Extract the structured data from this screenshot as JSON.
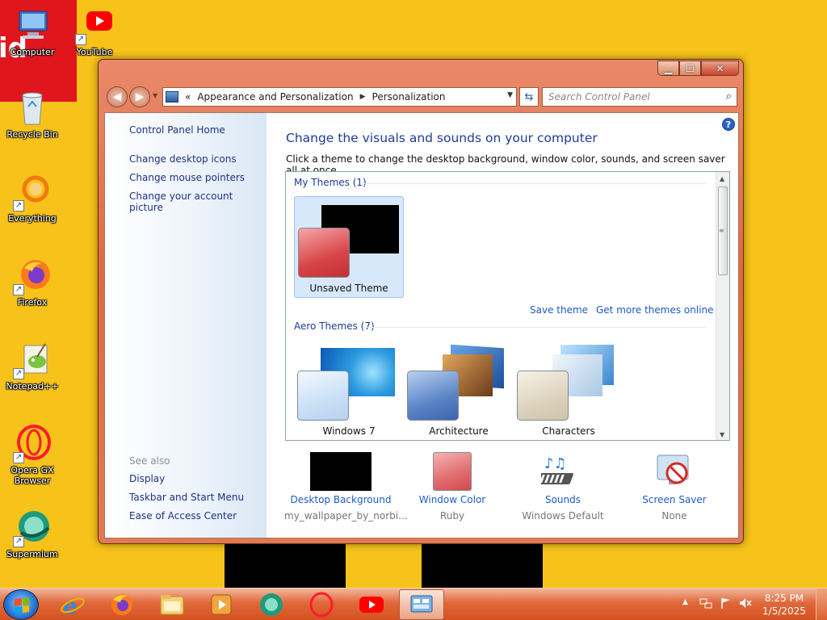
{
  "desktop": {
    "brand_fragment": "id",
    "icons": [
      {
        "label": "Computer",
        "icon": "computer-icon"
      },
      {
        "label": "YouTube",
        "icon": "youtube-icon"
      },
      {
        "label": "Recycle Bin",
        "icon": "recycle-bin-icon"
      },
      {
        "label": "Everything",
        "icon": "everything-search-icon"
      },
      {
        "label": "Firefox",
        "icon": "firefox-icon"
      },
      {
        "label": "Notepad++",
        "icon": "notepad-plus-plus-icon"
      },
      {
        "label": "Opera GX Browser",
        "icon": "opera-gx-icon"
      },
      {
        "label": "Supermium",
        "icon": "supermium-icon"
      }
    ],
    "background_color": "#f7c31a"
  },
  "window": {
    "caption_buttons": {
      "minimize": "▁",
      "maximize": "☐",
      "close": "✕"
    },
    "address": {
      "prefix": "«",
      "crumbs": [
        "Appearance and Personalization",
        "Personalization"
      ]
    },
    "search": {
      "placeholder": "Search Control Panel"
    },
    "left_pane": {
      "home": "Control Panel Home",
      "links": [
        "Change desktop icons",
        "Change mouse pointers",
        "Change your account picture"
      ],
      "see_also_label": "See also",
      "see_also": [
        "Display",
        "Taskbar and Start Menu",
        "Ease of Access Center"
      ]
    },
    "main": {
      "heading": "Change the visuals and sounds on your computer",
      "subheading": "Click a theme to change the desktop background, window color, sounds, and screen saver all at once.",
      "my_themes_label": "My Themes (1)",
      "my_themes": [
        {
          "name": "Unsaved Theme",
          "selected": true
        }
      ],
      "save_theme": "Save theme",
      "get_more": "Get more themes online",
      "aero_label": "Aero Themes (7)",
      "aero_themes": [
        {
          "name": "Windows 7"
        },
        {
          "name": "Architecture"
        },
        {
          "name": "Characters"
        }
      ],
      "bottom": [
        {
          "title": "Desktop Background",
          "value": "my_wallpaper_by_norbi...",
          "icon": "desktop-background-icon"
        },
        {
          "title": "Window Color",
          "value": "Ruby",
          "icon": "window-color-icon",
          "color": "#e06b6d"
        },
        {
          "title": "Sounds",
          "value": "Windows Default",
          "icon": "sounds-icon"
        },
        {
          "title": "Screen Saver",
          "value": "None",
          "icon": "screen-saver-icon"
        }
      ]
    }
  },
  "taskbar": {
    "apps": [
      "internet-explorer-icon",
      "firefox-icon",
      "file-explorer-icon",
      "media-player-icon",
      "supermium-icon",
      "opera-gx-icon",
      "youtube-icon",
      "control-panel-icon"
    ],
    "active_app": "control-panel-icon",
    "clock": {
      "time": "8:25 PM",
      "date": "1/5/2025"
    },
    "tray_chevron": "▲"
  }
}
